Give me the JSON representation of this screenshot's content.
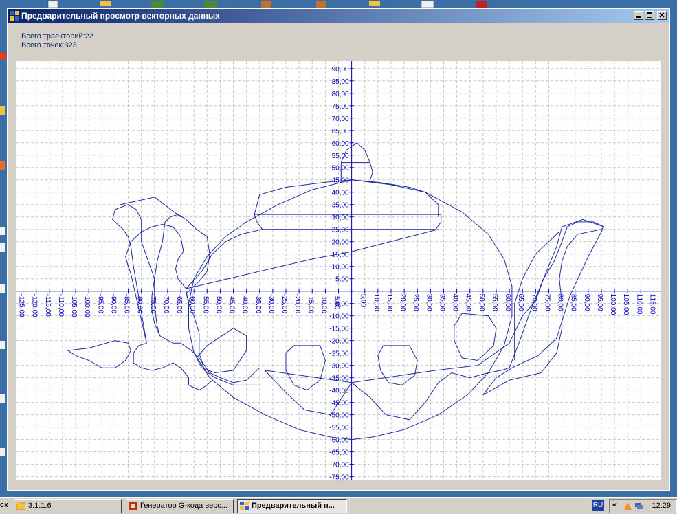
{
  "window": {
    "title": "Предварительный просмотр векторных данных",
    "buttons": [
      "minimize",
      "maximize",
      "close"
    ]
  },
  "info": {
    "trajectories": "Всего траекторий:22",
    "points": "Всего точек:323"
  },
  "chart_data": {
    "type": "scatter",
    "mode": "vector-paths",
    "xlim": [
      -127.5,
      117.5
    ],
    "ylim": [
      -76.5,
      93
    ],
    "grid": true,
    "axis_color": "#0000c0",
    "line_color": "#1a2aa0",
    "x_ticks": [
      "-125,00",
      "-120,00",
      "-115,00",
      "-110,00",
      "-105,00",
      "-100,00",
      "-95,00",
      "-90,00",
      "-85,00",
      "-80,00",
      "-75,00",
      "-70,00",
      "-65,00",
      "-60,00",
      "-55,00",
      "-50,00",
      "-45,00",
      "-40,00",
      "-35,00",
      "-30,00",
      "-25,00",
      "-20,00",
      "-15,00",
      "-10,00",
      "-5,00",
      "5,00",
      "10,00",
      "15,00",
      "20,00",
      "25,00",
      "30,00",
      "35,00",
      "40,00",
      "45,00",
      "50,00",
      "55,00",
      "60,00",
      "65,00",
      "70,00",
      "75,00",
      "80,00",
      "85,00",
      "90,00",
      "95,00",
      "100,00",
      "105,00",
      "110,00",
      "115,00"
    ],
    "y_ticks": [
      "90,00",
      "85,00",
      "80,00",
      "75,00",
      "70,00",
      "65,00",
      "60,00",
      "55,00",
      "50,00",
      "45,00",
      "40,00",
      "35,00",
      "30,00",
      "25,00",
      "20,00",
      "15,00",
      "10,00",
      "5,00",
      "-5,00",
      "-10,00",
      "-15,00",
      "-20,00",
      "-25,00",
      "-30,00",
      "-35,00",
      "-40,00",
      "-45,00",
      "-50,00",
      "-55,00",
      "-60,00",
      "-65,00",
      "-70,00",
      "-75,00"
    ],
    "trajectories": [
      [
        [
          0,
          45
        ],
        [
          15,
          43
        ],
        [
          28,
          40
        ],
        [
          42,
          32
        ],
        [
          52,
          23
        ],
        [
          58,
          13
        ],
        [
          61,
          2
        ],
        [
          61,
          -10
        ],
        [
          58,
          -22
        ],
        [
          52,
          -33
        ],
        [
          44,
          -42
        ],
        [
          33,
          -50
        ],
        [
          20,
          -56
        ],
        [
          8,
          -59
        ],
        [
          0,
          -60
        ],
        [
          -8,
          -59
        ],
        [
          -20,
          -56
        ],
        [
          -33,
          -50
        ],
        [
          -45,
          -43
        ],
        [
          -54,
          -35
        ],
        [
          -60,
          -25
        ],
        [
          -62,
          -15
        ],
        [
          -62,
          -5
        ],
        [
          -60,
          5
        ],
        [
          -55,
          14
        ],
        [
          -48,
          22
        ],
        [
          -40,
          28
        ],
        [
          -28,
          35
        ],
        [
          -15,
          41
        ],
        [
          0,
          45
        ]
      ],
      [
        [
          -35,
          39
        ],
        [
          -25,
          42
        ],
        [
          -10,
          44
        ],
        [
          0,
          45
        ],
        [
          10,
          44
        ],
        [
          22,
          42
        ],
        [
          28,
          40
        ],
        [
          33,
          35
        ],
        [
          33,
          30
        ]
      ],
      [
        [
          -35,
          39
        ],
        [
          -37,
          31
        ]
      ],
      [
        [
          -37,
          31
        ],
        [
          -36,
          28
        ],
        [
          -34,
          25
        ],
        [
          -22,
          25
        ],
        [
          32,
          25
        ],
        [
          34,
          28
        ],
        [
          34,
          31
        ],
        [
          -37,
          31
        ]
      ],
      [
        [
          -34,
          25
        ],
        [
          -42,
          23
        ],
        [
          -48,
          20
        ],
        [
          -53,
          15
        ],
        [
          -57,
          8
        ],
        [
          -63,
          1
        ]
      ],
      [
        [
          -63,
          1
        ],
        [
          -15,
          13
        ],
        [
          0,
          16
        ],
        [
          33,
          25
        ]
      ],
      [
        [
          -4,
          52
        ],
        [
          -2,
          57
        ],
        [
          2,
          60
        ],
        [
          5,
          57
        ],
        [
          7,
          52
        ],
        [
          8,
          48
        ],
        [
          7,
          45
        ]
      ],
      [
        [
          -4,
          52
        ],
        [
          -4,
          46
        ],
        [
          -4,
          44
        ]
      ],
      [
        [
          -4,
          52
        ],
        [
          7,
          52
        ]
      ],
      [
        [
          -63,
          0
        ],
        [
          -62,
          -5
        ],
        [
          -60,
          -10
        ],
        [
          -58,
          -17
        ],
        [
          -58,
          -25
        ],
        [
          -56,
          -32
        ],
        [
          -52,
          -35
        ],
        [
          -45,
          -38
        ],
        [
          -35,
          -38
        ]
      ],
      [
        [
          -62,
          -4
        ],
        [
          -63,
          -1
        ],
        [
          -58,
          4
        ],
        [
          -55,
          8
        ],
        [
          -54,
          15
        ],
        [
          -55,
          22
        ],
        [
          -59,
          25
        ],
        [
          -63,
          29
        ],
        [
          -66,
          31
        ],
        [
          -69,
          30
        ],
        [
          -71,
          28
        ],
        [
          -72,
          20
        ]
      ],
      [
        [
          -72,
          20
        ],
        [
          -74,
          12
        ],
        [
          -75,
          5
        ],
        [
          -76,
          -2
        ],
        [
          -76,
          -8
        ],
        [
          -75,
          -13
        ],
        [
          -73,
          -18
        ],
        [
          -68,
          -21
        ],
        [
          -65,
          -21
        ]
      ],
      [
        [
          -65,
          -21
        ],
        [
          -61,
          -24
        ],
        [
          -58,
          -27
        ],
        [
          -56,
          -30
        ],
        [
          -54,
          -33
        ],
        [
          -50,
          -35
        ],
        [
          -45,
          -37
        ],
        [
          -40,
          -36
        ],
        [
          -35,
          -31
        ]
      ],
      [
        [
          -78,
          -21
        ],
        [
          -81,
          -22
        ],
        [
          -83,
          -25
        ],
        [
          -83,
          -29
        ],
        [
          -80,
          -31
        ],
        [
          -76,
          -32
        ],
        [
          -72,
          -31
        ],
        [
          -68,
          -29
        ],
        [
          -65,
          -31
        ],
        [
          -62,
          -35
        ],
        [
          -62,
          -38
        ],
        [
          -60,
          -39
        ],
        [
          -58,
          -40
        ],
        [
          -55,
          -38
        ],
        [
          -53,
          -36
        ]
      ],
      [
        [
          -78,
          -21
        ],
        [
          -84,
          7
        ],
        [
          -85,
          10
        ],
        [
          -86,
          14
        ],
        [
          -84,
          20
        ],
        [
          -80,
          24
        ],
        [
          -76,
          26
        ],
        [
          -72,
          27
        ],
        [
          -68,
          26
        ],
        [
          -65,
          22
        ],
        [
          -64,
          16
        ],
        [
          -66,
          13
        ],
        [
          -67,
          9
        ],
        [
          -66,
          5
        ],
        [
          -63,
          1
        ]
      ],
      [
        [
          -78,
          -21
        ],
        [
          -83,
          10
        ],
        [
          -84,
          18
        ],
        [
          -85,
          22
        ],
        [
          -87,
          25
        ],
        [
          -89,
          27
        ],
        [
          -91,
          29
        ],
        [
          -90,
          33
        ],
        [
          -85,
          35
        ],
        [
          -82,
          33
        ],
        [
          -80,
          29
        ],
        [
          -80,
          20
        ],
        [
          -75,
          5
        ],
        [
          -75,
          -6
        ],
        [
          -74,
          -14
        ],
        [
          -73,
          -18
        ]
      ],
      [
        [
          -88,
          35
        ],
        [
          -75,
          38
        ],
        [
          -70,
          34
        ],
        [
          -65,
          30
        ]
      ],
      [
        [
          -108,
          -24
        ],
        [
          -100,
          -23
        ],
        [
          -90,
          -20
        ],
        [
          -85,
          -21
        ],
        [
          -84,
          -24
        ],
        [
          -86,
          -28
        ],
        [
          -90,
          -31
        ],
        [
          -95,
          -31
        ],
        [
          -100,
          -28
        ],
        [
          -105,
          -26
        ],
        [
          -108,
          -24
        ]
      ],
      [
        [
          -45,
          -15
        ],
        [
          -55,
          -22
        ],
        [
          -59,
          -27
        ],
        [
          -57,
          -31
        ],
        [
          -52,
          -33
        ],
        [
          -45,
          -32
        ],
        [
          -40,
          -24
        ],
        [
          -40,
          -18
        ],
        [
          -45,
          -15
        ]
      ],
      [
        [
          -22,
          -22
        ],
        [
          -12,
          -22
        ],
        [
          -10,
          -28
        ],
        [
          -12,
          -36
        ],
        [
          -17,
          -40
        ],
        [
          -22,
          -38
        ],
        [
          -25,
          -32
        ],
        [
          -25,
          -25
        ],
        [
          -22,
          -22
        ]
      ],
      [
        [
          12,
          -22
        ],
        [
          22,
          -22
        ],
        [
          25,
          -28
        ],
        [
          24,
          -34
        ],
        [
          19,
          -38
        ],
        [
          14,
          -37
        ],
        [
          11,
          -32
        ],
        [
          10,
          -26
        ],
        [
          12,
          -22
        ]
      ],
      [
        [
          42,
          -9
        ],
        [
          52,
          -10
        ],
        [
          55,
          -15
        ],
        [
          54,
          -22
        ],
        [
          48,
          -28
        ],
        [
          42,
          -27
        ],
        [
          39,
          -20
        ],
        [
          39,
          -14
        ],
        [
          42,
          -9
        ]
      ],
      [
        [
          -33,
          -32
        ],
        [
          -25,
          -41
        ],
        [
          -18,
          -48
        ],
        [
          -8,
          -50
        ],
        [
          -3,
          -42
        ],
        [
          0,
          -37
        ],
        [
          7,
          -43
        ],
        [
          13,
          -50
        ],
        [
          22,
          -52
        ],
        [
          28,
          -45
        ],
        [
          33,
          -37
        ],
        [
          38,
          -33
        ],
        [
          45,
          -35
        ],
        [
          52,
          -33
        ],
        [
          57,
          -32
        ],
        [
          60,
          -31
        ]
      ],
      [
        [
          -33,
          -32
        ],
        [
          0,
          -37
        ],
        [
          32,
          -32
        ],
        [
          48,
          -30
        ],
        [
          60,
          -21
        ]
      ],
      [
        [
          60,
          -21
        ],
        [
          65,
          -10
        ],
        [
          70,
          -4
        ],
        [
          73,
          5
        ],
        [
          78,
          18
        ],
        [
          80,
          26
        ],
        [
          88,
          29
        ],
        [
          96,
          26
        ],
        [
          95,
          25
        ],
        [
          86,
          23
        ],
        [
          82,
          18
        ],
        [
          80,
          12
        ],
        [
          79,
          5
        ],
        [
          80,
          -5
        ],
        [
          80,
          -15
        ],
        [
          78,
          -25
        ],
        [
          72,
          -33
        ],
        [
          60,
          -36
        ],
        [
          50,
          -42
        ],
        [
          55,
          -35
        ],
        [
          61,
          -31
        ],
        [
          71,
          -26
        ],
        [
          78,
          -19
        ],
        [
          83,
          -2
        ],
        [
          90,
          14
        ],
        [
          96,
          26
        ]
      ],
      [
        [
          60,
          -31
        ],
        [
          64,
          -20
        ],
        [
          68,
          -8
        ],
        [
          73,
          5
        ],
        [
          77,
          12
        ],
        [
          80,
          20
        ],
        [
          82,
          26
        ],
        [
          86,
          28
        ],
        [
          92,
          28
        ],
        [
          96,
          26
        ]
      ],
      [
        [
          62,
          -28
        ],
        [
          62,
          -5
        ],
        [
          65,
          5
        ],
        [
          70,
          15
        ],
        [
          77,
          22
        ],
        [
          79,
          24
        ]
      ]
    ]
  }
}
